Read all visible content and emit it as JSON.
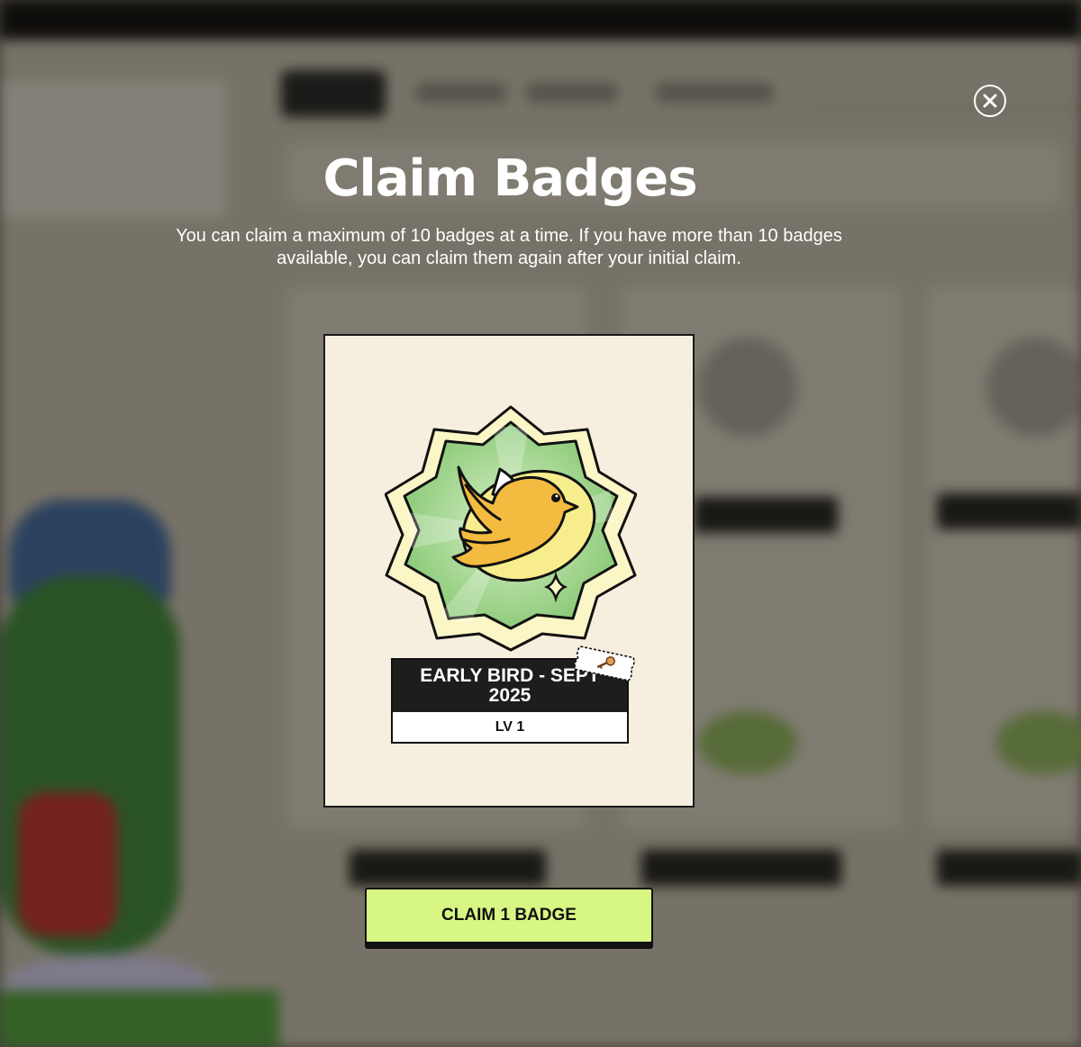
{
  "modal": {
    "title": "Claim Badges",
    "subtitle": "You can claim a maximum of 10 badges at a time. If you have more than 10 badges available, you can claim them again after your initial claim.",
    "close_icon": "close-icon"
  },
  "badge": {
    "name": "EARLY BIRD - SEPT 2025",
    "level": "LV 1",
    "art_icon": "bird-badge-icon",
    "tag_icon": "key-ticket-icon",
    "colors": {
      "card_bg": "#f6efdf",
      "badge_green": "#8fce7d",
      "bird_yellow": "#f3bb3f"
    }
  },
  "claim_button": {
    "label": "CLAIM 1 BADGE",
    "color": "#d8f683"
  }
}
